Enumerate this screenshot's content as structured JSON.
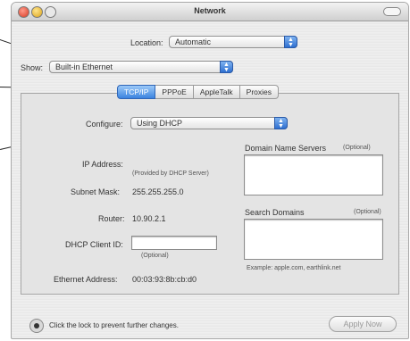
{
  "window": {
    "title": "Network"
  },
  "location": {
    "label": "Location:",
    "value": "Automatic"
  },
  "show": {
    "label": "Show:",
    "value": "Built-in Ethernet"
  },
  "tabs": [
    {
      "label": "TCP/IP",
      "selected": true
    },
    {
      "label": "PPPoE",
      "selected": false
    },
    {
      "label": "AppleTalk",
      "selected": false
    },
    {
      "label": "Proxies",
      "selected": false
    }
  ],
  "configure": {
    "label": "Configure:",
    "value": "Using DHCP"
  },
  "fields": {
    "ip_label": "IP Address:",
    "ip_note": "(Provided by DHCP Server)",
    "subnet_label": "Subnet Mask:",
    "subnet_value": "255.255.255.0",
    "router_label": "Router:",
    "router_value": "10.90.2.1",
    "dhcp_label": "DHCP Client ID:",
    "dhcp_value": "",
    "dhcp_note": "(Optional)",
    "ethernet_label": "Ethernet Address:",
    "ethernet_value": "00:03:93:8b:cb:d0"
  },
  "dns": {
    "label": "Domain Name Servers",
    "note": "(Optional)",
    "value": ""
  },
  "search": {
    "label": "Search Domains",
    "note": "(Optional)",
    "value": "",
    "example": "Example: apple.com, earthlink.net"
  },
  "footer": {
    "lock_text": "Click the lock to prevent further changes.",
    "apply_label": "Apply Now"
  }
}
